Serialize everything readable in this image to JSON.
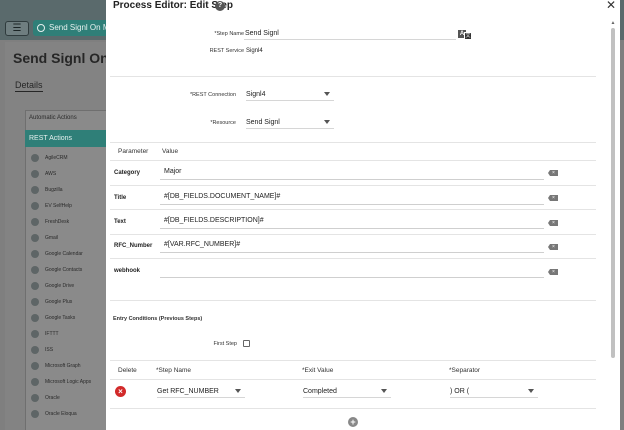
{
  "background": {
    "tab_label": "Send Signl On M",
    "page_title": "Send Signl On M",
    "details_label": "Details",
    "automatic_actions_label": "Automatic Actions",
    "rest_actions_label": "REST Actions",
    "actions": [
      "AgileCRM",
      "AWS",
      "Bugzilla",
      "EV SelfHelp",
      "FreshDesk",
      "Gmail",
      "Google Calendar",
      "Google Contacts",
      "Google Drive",
      "Google Plus",
      "Google Tasks",
      "IFTTT",
      "ISS",
      "Microsoft Graph",
      "Microsoft Logic Apps",
      "Oracle",
      "Oracle Eloqua"
    ]
  },
  "modal": {
    "title": "Process Editor: Edit Step",
    "step_name_label": "*Step Name",
    "step_name_value": "Send Signl",
    "rest_service_label": "REST Service",
    "rest_service_value": "Signl4",
    "rest_connection_label": "*REST Connection",
    "rest_connection_value": "Signl4",
    "resource_label": "*Resource",
    "resource_value": "Send Signl",
    "param_header_parameter": "Parameter",
    "param_header_value": "Value",
    "parameters": [
      {
        "name": "Category",
        "value": "Major"
      },
      {
        "name": "Title",
        "value": "#[DB_FIELDS.DOCUMENT_NAME]#"
      },
      {
        "name": "Text",
        "value": "#[DB_FIELDS.DESCRIPTION]#"
      },
      {
        "name": "RFC_Number",
        "value": "#[VAR.RFC_NUMBER]#"
      },
      {
        "name": "webhook",
        "value": ""
      }
    ],
    "entry_conditions_label": "Entry Conditions (Previous Steps)",
    "first_step_label": "First Step",
    "grid_headers": {
      "delete": "Delete",
      "step_name": "*Step Name",
      "exit_value": "*Exit Value",
      "separator": "*Separator"
    },
    "condition_row": {
      "step_name": "Get RFC_NUMBER",
      "exit_value": "Completed",
      "separator": ") OR ("
    }
  }
}
